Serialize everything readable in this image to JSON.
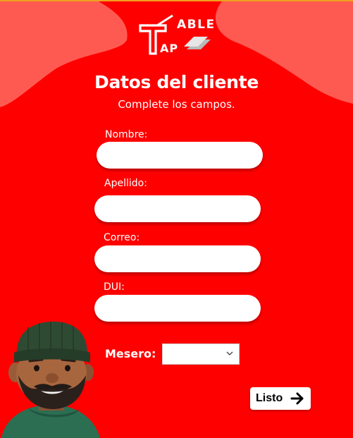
{
  "brand": {
    "logo_top": "ABLE",
    "logo_bottom": "AP"
  },
  "form": {
    "title": "Datos del cliente",
    "subtitle": "Complete los campos.",
    "fields": [
      {
        "label": "Nombre:",
        "value": "",
        "placeholder": ""
      },
      {
        "label": "Apellido:",
        "value": "",
        "placeholder": ""
      },
      {
        "label": "Correo:",
        "value": "",
        "placeholder": ""
      },
      {
        "label": "DUI:",
        "value": "",
        "placeholder": ""
      }
    ],
    "mesero": {
      "label": "Mesero:",
      "selected": ""
    },
    "submit_label": "Listo"
  },
  "icons": {
    "submit": "arrow-right-icon",
    "select": "chevron-down-icon",
    "avatar": "waiter-avatar-illustration"
  },
  "colors": {
    "background": "#ff0000",
    "blob": "#ff5a52",
    "text": "#ffffff",
    "button_text": "#000000"
  }
}
